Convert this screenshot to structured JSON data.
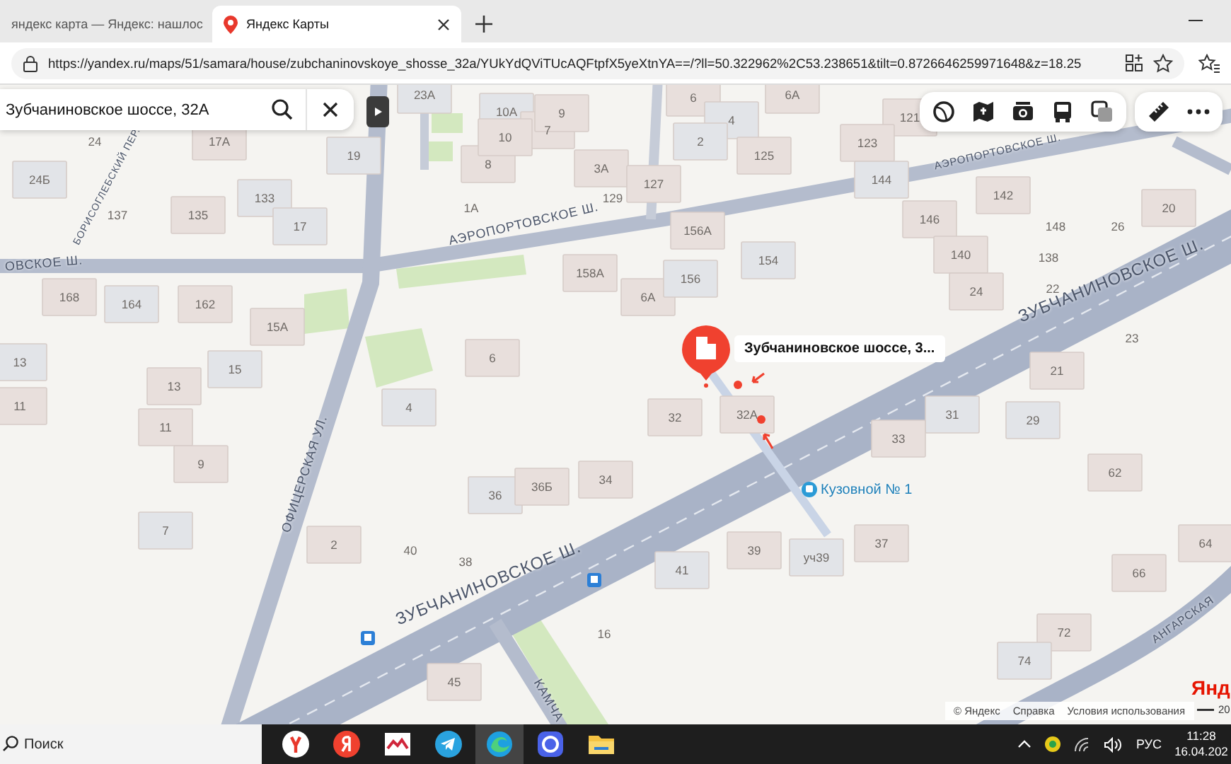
{
  "browser": {
    "tabs": [
      {
        "title": "яндекс карта — Яндекс: нашлос",
        "selected": false
      },
      {
        "title": "Яндекс Карты",
        "selected": true
      }
    ],
    "url": "https://yandex.ru/maps/51/samara/house/zubchaninovskoye_shosse_32a/YUkYdQViTUcAQFtpfX5yeXtnYA==/?ll=50.322962%2C53.238651&tilt=0.8726646259971648&z=18.25"
  },
  "search": {
    "value": "Зубчаниновское шоссе, 32A"
  },
  "map": {
    "houses": [
      "23A",
      "6",
      "6A",
      "10A",
      "7",
      "9",
      "4",
      "121",
      "24",
      "17A",
      "19",
      "8",
      "10",
      "2",
      "125",
      "123",
      "24Б",
      "3A",
      "127",
      "144",
      "142",
      "137",
      "135",
      "133",
      "1A",
      "129",
      "146",
      "20",
      "17",
      "156A",
      "148",
      "26",
      "158A",
      "154",
      "140",
      "138",
      "168",
      "164",
      "162",
      "6A",
      "156",
      "24",
      "22",
      "15A",
      "13",
      "6",
      "23",
      "13",
      "15",
      "21",
      "11",
      "4",
      "32",
      "32A",
      "31",
      "11",
      "33",
      "29",
      "9",
      "62",
      "36",
      "36Б",
      "34",
      "7",
      "2",
      "40",
      "39",
      "уч39",
      "37",
      "64",
      "38",
      "41",
      "66",
      "16",
      "72",
      "74",
      "45"
    ],
    "streets": [
      "БОРИСОГЛЕБСКИЙ ПЕР.",
      "АЭРОПОРТОВСКОЕ Ш.",
      "АЭРОПОРТОВСКОЕ Ш.",
      "ЗУБЧАНИНОВСКОЕ Ш.",
      "ЗУБЧАНИНОВСКОЕ Ш.",
      "ОФИЦЕРСКАЯ УЛ.",
      "КАМЧА",
      "АНГАРСКАЯ",
      "ОВСКОЕ Ш."
    ],
    "place": {
      "label": "Зубчаниновское шоссе, 3..."
    },
    "stop": {
      "name": "Кузовной № 1"
    },
    "logo": "Янд",
    "scale": "20",
    "footer": [
      "© Яндекс",
      "Справка",
      "Условия использования"
    ]
  },
  "taskbar": {
    "search_placeholder": "Поиск",
    "language": "РУС",
    "time": "11:28",
    "date": "16.04.202"
  }
}
